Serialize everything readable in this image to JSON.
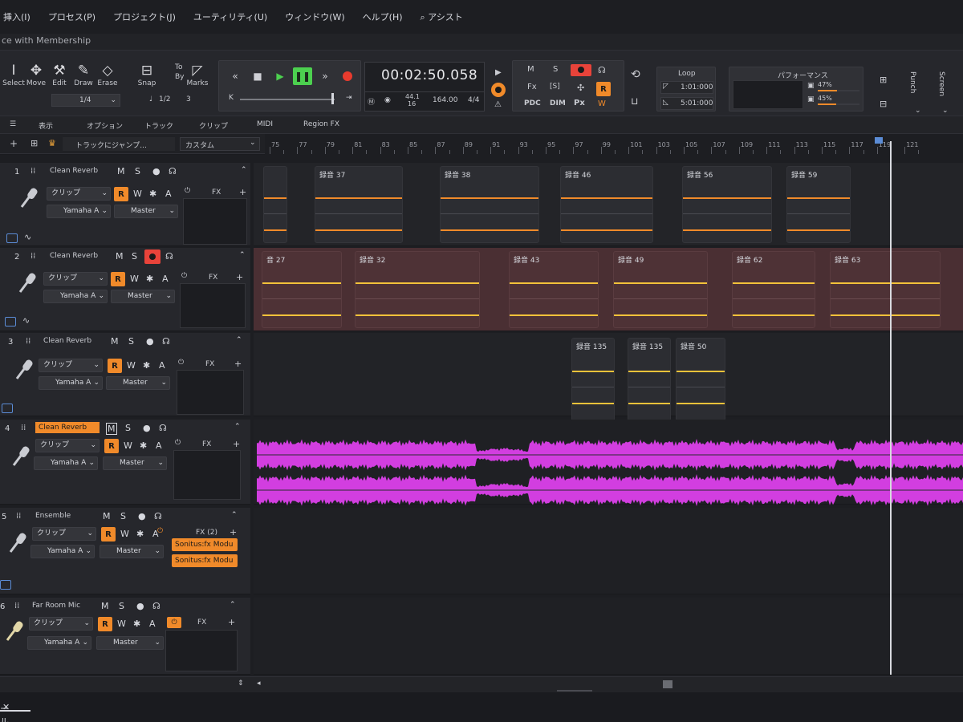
{
  "menu": [
    "挿入(I)",
    "プロセス(P)",
    "プロジェクト(J)",
    "ユーティリティ(U)",
    "ウィンドウ(W)",
    "ヘルプ(H)",
    "アシスト"
  ],
  "title": "ce with Membership",
  "tools": {
    "select": "Select",
    "move": "Move",
    "edit": "Edit",
    "draw": "Draw",
    "erase": "Erase",
    "snap": "Snap",
    "to": "To",
    "by": "By",
    "marks": "Marks",
    "quant": "1/4",
    "snap_val": "1/2",
    "marks_val": "3"
  },
  "transport": {
    "time": "00:02:50.058",
    "sample_rate": "44.1",
    "bit_depth": "16",
    "tempo": "164.00",
    "meter": "4/4"
  },
  "mix_buttons": {
    "m": "M",
    "fx": "Fx",
    "s": "[S]",
    "r": "R",
    "pdc": "PDC",
    "dim": "DIM",
    "px": "Px"
  },
  "loop": {
    "label": "Loop",
    "start": "1:01:000",
    "end": "5:01:000"
  },
  "performance": {
    "label": "パフォーマンス",
    "cpu": "47%",
    "disk": "45%",
    "cpu_fill": 0.47,
    "disk_fill": 0.45
  },
  "right_tools": {
    "punch": "Punch",
    "screen": "Screen"
  },
  "subbar": {
    "view": "表示",
    "options": "オプション",
    "track": "トラック",
    "clip": "クリップ",
    "midi": "MIDI",
    "region_fx": "Region FX"
  },
  "jump": {
    "label": "トラックにジャンプ...",
    "preset": "カスタム"
  },
  "ruler_ticks": [
    "75",
    "77",
    "79",
    "81",
    "83",
    "85",
    "87",
    "89",
    "91",
    "93",
    "95",
    "97",
    "99",
    "101",
    "103",
    "105",
    "107",
    "109",
    "111",
    "113",
    "115",
    "117",
    "119",
    "121"
  ],
  "tracks": [
    {
      "num": "1",
      "name": "Clean Reverb",
      "mode": "クリップ",
      "input": "Yamaha A",
      "output": "Master",
      "fx": "FX",
      "m": "M",
      "s": "S",
      "r": "R",
      "w": "W",
      "a": "A"
    },
    {
      "num": "2",
      "name": "Clean Reverb",
      "mode": "クリップ",
      "input": "Yamaha A",
      "output": "Master",
      "fx": "FX",
      "m": "M",
      "s": "S",
      "r": "R",
      "w": "W",
      "a": "A"
    },
    {
      "num": "3",
      "name": "Clean Reverb",
      "mode": "クリップ",
      "input": "Yamaha A",
      "output": "Master",
      "fx": "FX",
      "m": "M",
      "s": "S",
      "r": "R",
      "w": "W",
      "a": "A"
    },
    {
      "num": "4",
      "name": "Clean Reverb",
      "mode": "クリップ",
      "input": "Yamaha A",
      "output": "Master",
      "fx": "FX",
      "m": "M",
      "s": "S",
      "r": "R",
      "w": "W",
      "a": "A"
    },
    {
      "num": "5",
      "name": "Ensemble",
      "mode": "クリップ",
      "input": "Yamaha A",
      "output": "Master",
      "fx": "FX (2)",
      "m": "M",
      "s": "S",
      "r": "R",
      "w": "W",
      "a": "A",
      "plugins": [
        "Sonitus:fx Modu",
        "Sonitus:fx Modu"
      ]
    },
    {
      "num": "6",
      "name": "Far Room Mic",
      "mode": "クリップ",
      "input": "Yamaha A",
      "output": "Master",
      "fx": "FX",
      "m": "M",
      "s": "S",
      "r": "R",
      "w": "W",
      "a": "A"
    }
  ],
  "clips": {
    "track1": [
      "録音 37",
      "録音 38",
      "録音 46",
      "録音 56",
      "録音 59"
    ],
    "track2": [
      "音 27",
      "録音 32",
      "録音 43",
      "録音 49",
      "録音 62",
      "録音 63"
    ],
    "track3": [
      "録音 135",
      "録音 135",
      "録音 50"
    ]
  },
  "footer": {
    "tab": "ール"
  },
  "colors": {
    "accent": "#f08a2a",
    "record": "#e8433a",
    "play": "#4cd04f",
    "waveform": "#d23ee0",
    "track2_lane": "#4a2f33"
  }
}
